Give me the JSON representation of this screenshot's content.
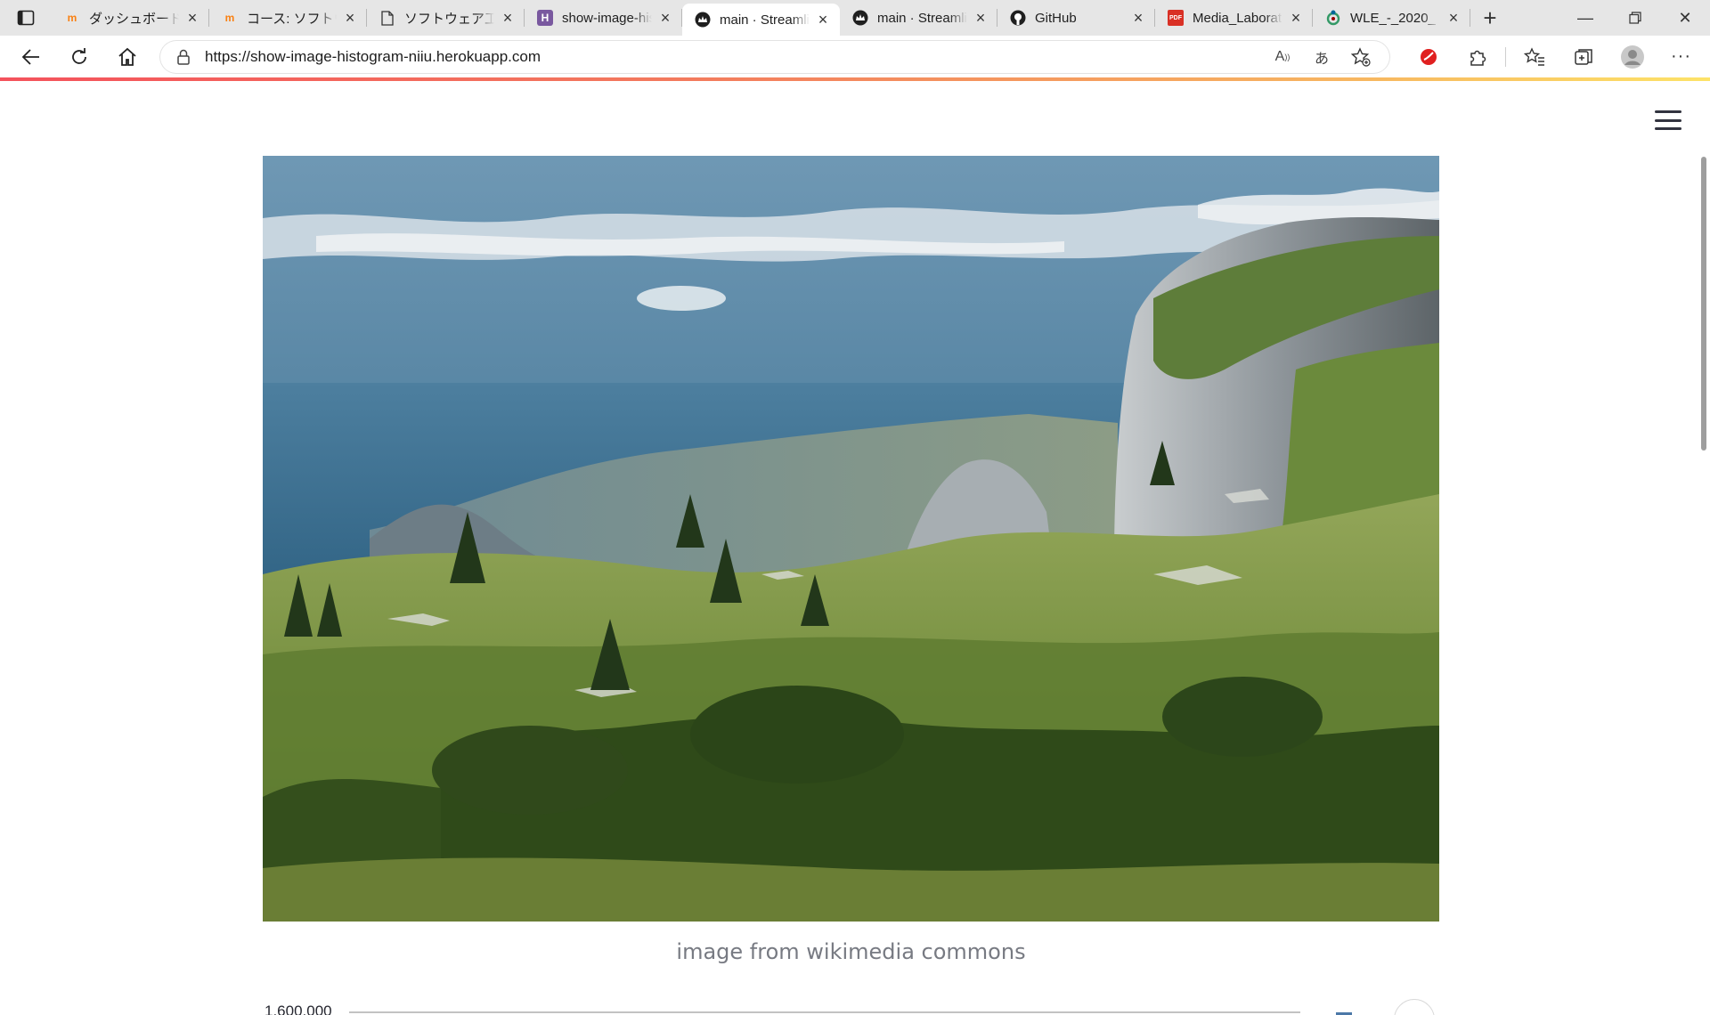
{
  "browser": {
    "tabs": [
      {
        "title": "ダッシュボード",
        "favicon": "moodle-icon",
        "active": false
      },
      {
        "title": "コース: ソフトウェア工学",
        "favicon": "moodle-icon",
        "active": false
      },
      {
        "title": "ソフトウェア工学",
        "favicon": "document-icon",
        "active": false
      },
      {
        "title": "show-image-histogram",
        "favicon": "heroku-icon",
        "active": false
      },
      {
        "title": "main · Streamlit",
        "favicon": "streamlit-crown-icon",
        "active": true
      },
      {
        "title": "main · Streamlit",
        "favicon": "streamlit-crown-icon",
        "active": false
      },
      {
        "title": "GitHub",
        "favicon": "github-icon",
        "active": false
      },
      {
        "title": "Media_Laboratory",
        "favicon": "pdf-icon",
        "active": false
      },
      {
        "title": "WLE_-_2020_",
        "favicon": "wikimedia-icon",
        "active": false
      }
    ],
    "address_bar": {
      "url": "https://show-image-histogram-niiu.herokuapp.com"
    },
    "accent_gradient": [
      "#f4525c",
      "#f7b760",
      "#fde368"
    ]
  },
  "page": {
    "image_caption": "image from wikimedia commons",
    "chart_peek_tick": "1,600,000"
  },
  "colors": {
    "tab_strip_bg": "#e6e6e6",
    "caption_text": "#777a82",
    "series_blue": "#4c78a8"
  }
}
